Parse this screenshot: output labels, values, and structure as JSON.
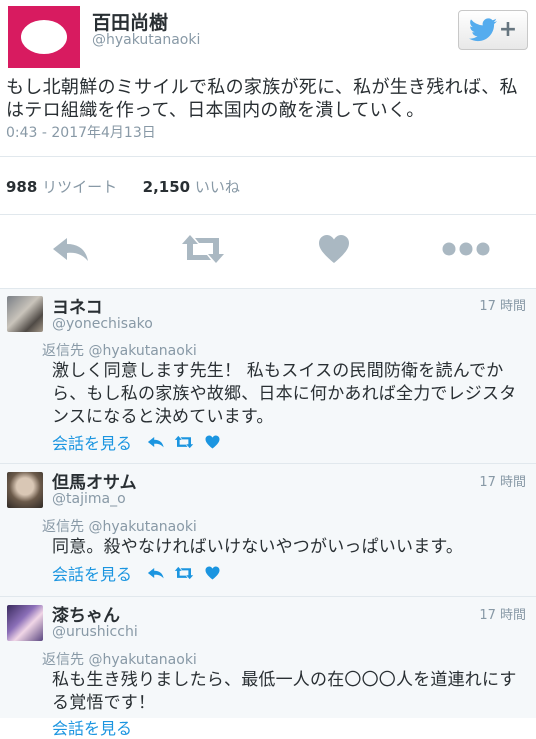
{
  "tweet": {
    "display_name": "百田尚樹",
    "screen_name": "@hyakutanaoki",
    "text": "もし北朝鮮のミサイルで私の家族が死に、私が生き残れば、私はテロ組織を作って、日本国内の敵を潰していく。",
    "timestamp": "0:43 - 2017年4月13日",
    "retweet_count": "988",
    "retweet_label": "リツイート",
    "like_count": "2,150",
    "like_label": "いいね",
    "follow_plus": "+"
  },
  "colors": {
    "avatar_bg": "#d81b60",
    "twitter_blue": "#55acee",
    "link_blue": "#1b95e0",
    "muted": "#8899a6",
    "replies_bg": "#f5f8fa"
  },
  "replies": [
    {
      "display_name": "ヨネコ",
      "screen_name": "@yonechisako",
      "time": "17 時間",
      "reply_prefix": "返信先",
      "reply_to": "@hyakutanaoki",
      "text": "激しく同意します先生！ 私もスイスの民間防衛を読んでから、もし私の家族や故郷、日本に何かあれば全力でレジスタンスになると決めています。",
      "conversation_label": "会話を見る"
    },
    {
      "display_name": "但馬オサム",
      "screen_name": "@tajima_o",
      "time": "17 時間",
      "reply_prefix": "返信先",
      "reply_to": "@hyakutanaoki",
      "text": "同意。殺やなければいけないやつがいっぱいいます。",
      "conversation_label": "会話を見る"
    },
    {
      "display_name": "漆ちゃん",
      "screen_name": "@urushicchi",
      "time": "17 時間",
      "reply_prefix": "返信先",
      "reply_to": "@hyakutanaoki",
      "text": "私も生き残りましたら、最低一人の在〇〇〇人を道連れにする覚悟です！",
      "conversation_label": "会話を見る"
    }
  ]
}
